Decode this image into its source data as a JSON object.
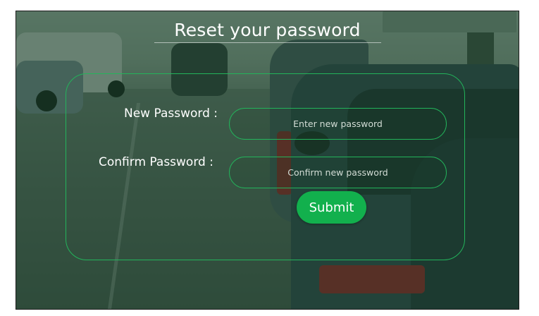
{
  "page": {
    "title": "Reset your password"
  },
  "form": {
    "new_password": {
      "label": "New Password :",
      "placeholder": "Enter new password",
      "value": ""
    },
    "confirm_password": {
      "label": "Confirm Password :",
      "placeholder": "Confirm new password",
      "value": ""
    },
    "submit_label": "Submit"
  },
  "colors": {
    "accent": "#12b04d",
    "panel_border": "#23b45b",
    "overlay": "#123a22",
    "text": "#ffffff"
  }
}
